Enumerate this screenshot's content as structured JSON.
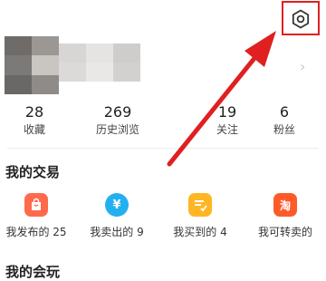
{
  "header": {
    "settings_icon": "gear-icon",
    "highlight_color": "#e02020"
  },
  "profile": {
    "avatar_colors": [
      "#6f6b68",
      "#9b9794",
      "#7c7a78",
      "#c9c6c2",
      "#6a6866",
      "#8e8b88"
    ],
    "name_colors": [
      "#d8d6d4",
      "#e6e4e2",
      "#cfcdcb",
      "#dcdad8",
      "#e9e8e7",
      "#d3d1cf"
    ],
    "chevron": "›"
  },
  "stats": [
    {
      "value": "28",
      "label": "收藏"
    },
    {
      "value": "269",
      "label": "历史浏览"
    },
    {
      "value": "19",
      "label": "关注"
    },
    {
      "value": "6",
      "label": "粉丝"
    }
  ],
  "trade": {
    "title": "我的交易",
    "items": [
      {
        "label": "我发布的 25",
        "icon": "bag-icon",
        "glyph": "🛍",
        "color": "#ff6a4d"
      },
      {
        "label": "我卖出的 9",
        "icon": "yen-icon",
        "glyph": "¥",
        "color": "#23b0f0"
      },
      {
        "label": "我买到的 4",
        "icon": "checklist-icon",
        "glyph": "✓",
        "color": "#ffb524"
      },
      {
        "label": "我可转卖的",
        "icon": "tao-icon",
        "glyph": "淘",
        "color": "#ff5a2a"
      }
    ]
  },
  "fun": {
    "title": "我的会玩"
  }
}
